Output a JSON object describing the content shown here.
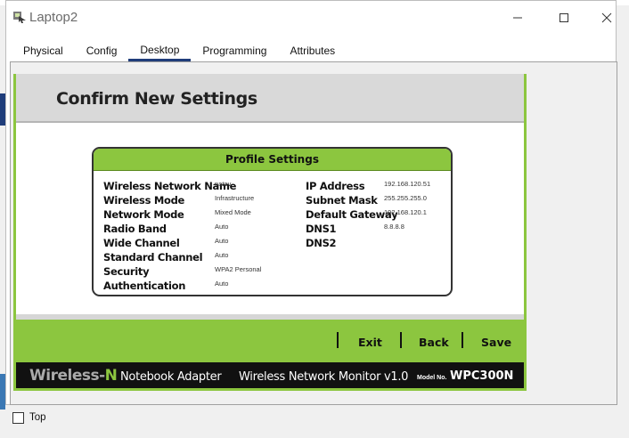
{
  "window": {
    "title": "Laptop2"
  },
  "tabs": [
    {
      "label": "Physical"
    },
    {
      "label": "Config"
    },
    {
      "label": "Desktop"
    },
    {
      "label": "Programming"
    },
    {
      "label": "Attributes"
    }
  ],
  "active_tab": "Desktop",
  "panel": {
    "heading": "Confirm New Settings",
    "profile_title": "Profile Settings",
    "wireless": [
      {
        "label": "Wireless Network Name",
        "value": "natav"
      },
      {
        "label": "Wireless Mode",
        "value": "Infrastructure"
      },
      {
        "label": "Network Mode",
        "value": "Mixed Mode"
      },
      {
        "label": "Radio Band",
        "value": "Auto"
      },
      {
        "label": "Wide Channel",
        "value": "Auto"
      },
      {
        "label": "Standard Channel",
        "value": "Auto"
      },
      {
        "label": "Security",
        "value": "WPA2 Personal"
      },
      {
        "label": "Authentication",
        "value": "Auto"
      }
    ],
    "network": [
      {
        "label": "IP Address",
        "value": "192.168.120.51"
      },
      {
        "label": "Subnet Mask",
        "value": "255.255.255.0"
      },
      {
        "label": "Default Gateway",
        "value": "192.168.120.1"
      },
      {
        "label": "DNS1",
        "value": "8.8.8.8"
      },
      {
        "label": "DNS2",
        "value": ""
      }
    ],
    "actions": {
      "exit": "Exit",
      "back": "Back",
      "save": "Save"
    },
    "brand": {
      "wireless": "Wireless-",
      "n": "N",
      "adapter": "Notebook Adapter",
      "monitor": "Wireless Network Monitor  v1.0",
      "model_no_label": "Model No.",
      "model": "WPC300N"
    }
  },
  "bottom": {
    "top_label": "Top"
  },
  "colors": {
    "accent_green": "#8cc63f",
    "tab_underline": "#1f3d7a",
    "brand_bar": "#111111"
  }
}
